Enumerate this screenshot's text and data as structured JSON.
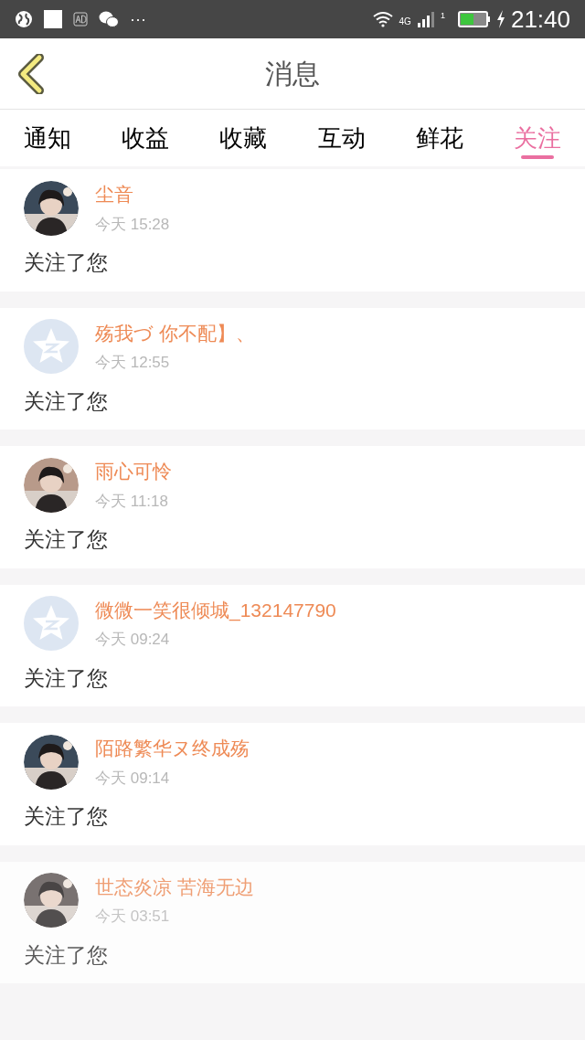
{
  "status_bar": {
    "more": "···",
    "network": "4G",
    "sim": "1",
    "time": "21:40"
  },
  "header": {
    "title": "消息"
  },
  "tabs": [
    {
      "label": "通知",
      "selected": false
    },
    {
      "label": "收益",
      "selected": false
    },
    {
      "label": "收藏",
      "selected": false
    },
    {
      "label": "互动",
      "selected": false
    },
    {
      "label": "鲜花",
      "selected": false
    },
    {
      "label": "关注",
      "selected": true
    }
  ],
  "messages": [
    {
      "kind": "picture",
      "name": "尘音",
      "time": "今天 15:28",
      "text": "关注了您",
      "faded": false
    },
    {
      "kind": "default",
      "name": "殇我づ 你不配】、",
      "time": "今天 12:55",
      "text": "关注了您",
      "faded": false
    },
    {
      "kind": "picture",
      "name": "雨心可怜",
      "time": "今天 11:18",
      "text": "关注了您",
      "faded": false
    },
    {
      "kind": "default",
      "name": "微微一笑很倾城_132147790",
      "time": "今天 09:24",
      "text": "关注了您",
      "faded": false
    },
    {
      "kind": "picture",
      "name": "陌路繁华ヌ终成殇",
      "time": "今天 09:14",
      "text": "关注了您",
      "faded": false
    },
    {
      "kind": "picture",
      "name": "世态炎凉 苦海无边",
      "time": "今天 03:51",
      "text": "关注了您",
      "faded": true
    }
  ]
}
